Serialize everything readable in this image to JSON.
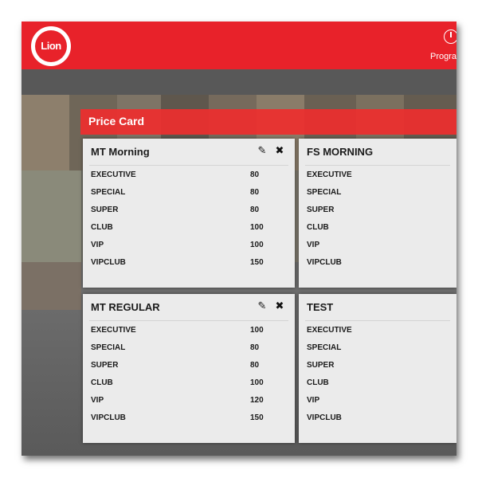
{
  "app": {
    "logo_text": "Lion",
    "nav_label": "Program"
  },
  "price_card": {
    "title": "Price Card",
    "cards": [
      {
        "title": "MT Morning",
        "editable": true,
        "rows": [
          {
            "label": "EXECUTIVE",
            "value": "80"
          },
          {
            "label": "SPECIAL",
            "value": "80"
          },
          {
            "label": "SUPER",
            "value": "80"
          },
          {
            "label": "CLUB",
            "value": "100"
          },
          {
            "label": "VIP",
            "value": "100"
          },
          {
            "label": "VIPCLUB",
            "value": "150"
          }
        ]
      },
      {
        "title": "FS MORNING",
        "editable": false,
        "rows": [
          {
            "label": "EXECUTIVE",
            "value": ""
          },
          {
            "label": "SPECIAL",
            "value": ""
          },
          {
            "label": "SUPER",
            "value": ""
          },
          {
            "label": "CLUB",
            "value": ""
          },
          {
            "label": "VIP",
            "value": ""
          },
          {
            "label": "VIPCLUB",
            "value": ""
          }
        ]
      },
      {
        "title": "MT REGULAR",
        "editable": true,
        "rows": [
          {
            "label": "EXECUTIVE",
            "value": "100"
          },
          {
            "label": "SPECIAL",
            "value": "80"
          },
          {
            "label": "SUPER",
            "value": "80"
          },
          {
            "label": "CLUB",
            "value": "100"
          },
          {
            "label": "VIP",
            "value": "120"
          },
          {
            "label": "VIPCLUB",
            "value": "150"
          }
        ]
      },
      {
        "title": "TEST",
        "editable": false,
        "rows": [
          {
            "label": "EXECUTIVE",
            "value": ""
          },
          {
            "label": "SPECIAL",
            "value": ""
          },
          {
            "label": "SUPER",
            "value": ""
          },
          {
            "label": "CLUB",
            "value": ""
          },
          {
            "label": "VIP",
            "value": ""
          },
          {
            "label": "VIPCLUB",
            "value": ""
          }
        ]
      }
    ]
  },
  "icons": {
    "edit": "pencil-icon",
    "delete": "close-icon",
    "nav": "clock-icon"
  },
  "colors": {
    "brand_red": "#e8222a",
    "card_bg": "#ebebeb",
    "page_dark": "#5a5a5a"
  }
}
